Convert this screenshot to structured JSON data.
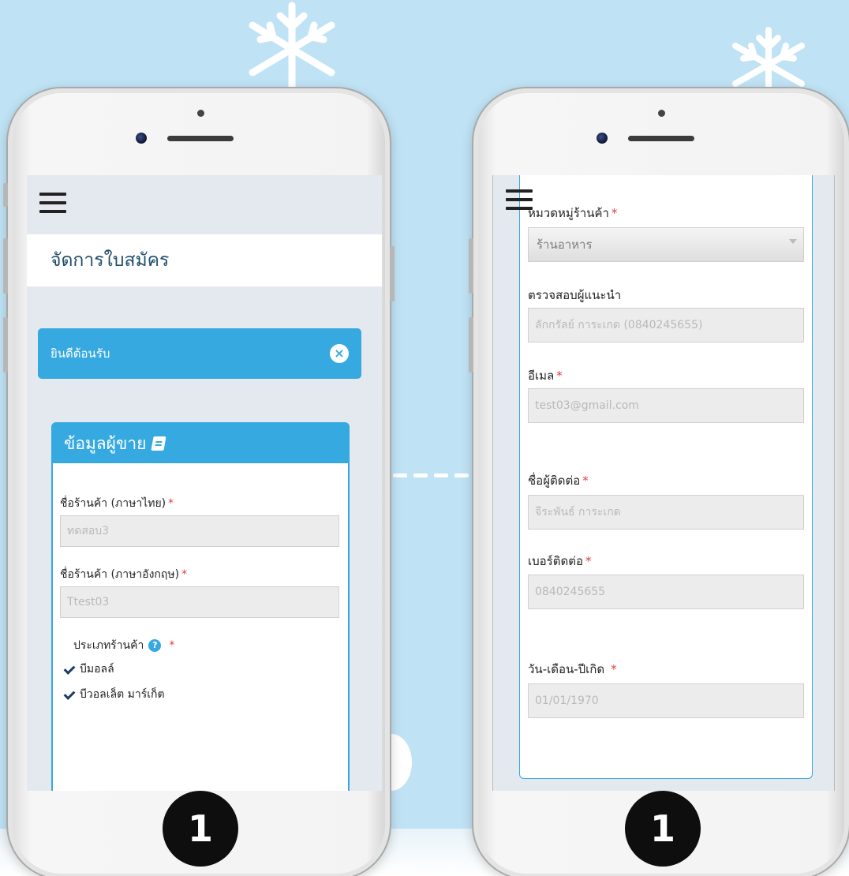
{
  "left_phone": {
    "home_label": "1",
    "page_title": "จัดการใบสมัคร",
    "alert_text": "ยินดีต้อนรับ",
    "alert_close": "×",
    "panel_title": "ข้อมูลผู้ขาย",
    "fields": [
      {
        "label": "ชื่อร้านค้า (ภาษาไทย)",
        "required": "*",
        "value": "ทดสอบ3"
      },
      {
        "label": "ชื่อร้านค้า (ภาษาอังกฤษ)",
        "required": "*",
        "value": "Ttest03"
      }
    ],
    "store_type": {
      "label": "ประเภทร้านค้า",
      "help": "?",
      "required": "*",
      "options": [
        {
          "label": "บีมอลล์",
          "checked": true
        },
        {
          "label": "บีวอลเล็ต มาร์เก็ต",
          "checked": true
        }
      ]
    }
  },
  "right_phone": {
    "home_label": "1",
    "category": {
      "label": "หมวดหมู่ร้านค้า",
      "required": "*",
      "value": "ร้านอาหาร"
    },
    "referrer": {
      "label": "ตรวจสอบผู้แนะนำ",
      "value": "ลักกรัลย์ การะเกด (0840245655)"
    },
    "email": {
      "label": "อีเมล",
      "required": "*",
      "value": "test03@gmail.com"
    },
    "contact_name": {
      "label": "ชื่อผู้ติดต่อ",
      "required": "*",
      "value": "จีระพันธ์ การะเกด"
    },
    "phone": {
      "label": "เบอร์ติดต่อ",
      "required": "*",
      "value": "0840245655"
    },
    "birthdate": {
      "label": "วัน-เดือน-ปีเกิด",
      "required": "*",
      "value": "01/01/1970"
    }
  },
  "colors": {
    "background": "#bfe3f5",
    "accent": "#36a9e1",
    "required": "#e23c3c"
  }
}
